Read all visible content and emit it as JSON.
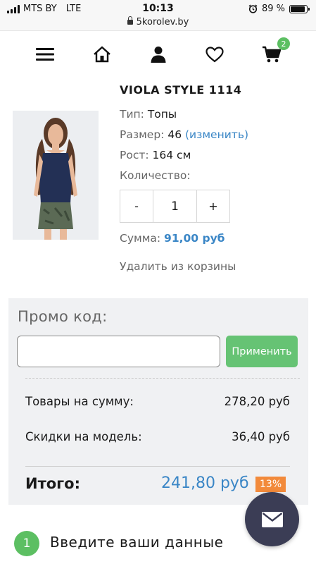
{
  "status_bar": {
    "carrier": "MTS BY",
    "network": "LTE",
    "time": "10:13",
    "battery": "89 %"
  },
  "url_bar": {
    "domain": "5korolev.by"
  },
  "nav": {
    "icons": [
      "menu-icon",
      "home-icon",
      "user-icon",
      "heart-icon",
      "cart-icon"
    ],
    "cart_count": "2"
  },
  "product": {
    "title": "VIOLA STYLE 1114",
    "type_label": "Тип:",
    "type_value": "Топы",
    "size_label": "Размер:",
    "size_value": "46",
    "size_change": "(изменить)",
    "height_label": "Рост:",
    "height_value": "164 см",
    "qty_label": "Количество:",
    "qty_minus": "-",
    "qty_value": "1",
    "qty_plus": "+",
    "sum_label": "Сумма:",
    "sum_value": "91,00 руб",
    "remove": "Удалить из корзины"
  },
  "summary": {
    "promo_label": "Промо код:",
    "promo_value": "",
    "apply": "Применить",
    "goods_label": "Товары на сумму:",
    "goods_value": "278,20 руб",
    "discount_label": "Скидки на модель:",
    "discount_value": "36,40 руб",
    "total_label": "Итого:",
    "total_value": "241,80 руб",
    "total_percent": "13%"
  },
  "step": {
    "number": "1",
    "text": "Введите ваши данные"
  },
  "colors": {
    "accent_blue": "#3a86c6",
    "accent_green": "#5cbf62",
    "badge_orange": "#f28a3b",
    "mail_button": "#3b3d55"
  }
}
